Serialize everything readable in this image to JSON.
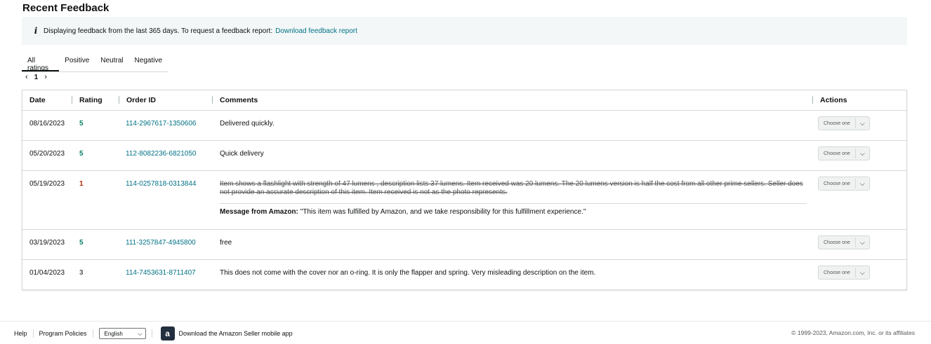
{
  "page": {
    "title": "Recent Feedback"
  },
  "info": {
    "icon": "info-icon",
    "text": "Displaying feedback from the last 365 days. To request a feedback report:",
    "link": "Download feedback report"
  },
  "tabs": [
    {
      "label": "All ratings",
      "active": true
    },
    {
      "label": "Positive",
      "active": false
    },
    {
      "label": "Neutral",
      "active": false
    },
    {
      "label": "Negative",
      "active": false
    }
  ],
  "pager": {
    "prev": "‹",
    "page": "1",
    "next": "›"
  },
  "table": {
    "headers": {
      "date": "Date",
      "rating": "Rating",
      "order_id": "Order ID",
      "comments": "Comments",
      "actions": "Actions"
    },
    "rows": [
      {
        "date": "08/16/2023",
        "rating": "5",
        "order_id": "114-2967617-1350606",
        "comment": "Delivered quickly.",
        "action": "Choose one"
      },
      {
        "date": "05/20/2023",
        "rating": "5",
        "order_id": "112-8082236-6821050",
        "comment": "Quick delivery",
        "action": "Choose one"
      },
      {
        "date": "05/19/2023",
        "rating": "1",
        "order_id": "114-0257818-0313844",
        "comment": "Item shows a flashlight with strength of 47 lumens , description lists 37 lumens. Item received was 20 lumens. The 20 lumens version is half the cost from all other prime sellers. Seller does not provide an accurate description of this item. Item received is not as the photo represents.",
        "message_label": "Message from Amazon:",
        "message_text": "\"This item was fulfilled by Amazon, and we take responsibility for this fulfillment experience.\"",
        "action": "Choose one"
      },
      {
        "date": "03/19/2023",
        "rating": "5",
        "order_id": "111-3257847-4945800",
        "comment": "free",
        "action": "Choose one"
      },
      {
        "date": "01/04/2023",
        "rating": "3",
        "order_id": "114-7453631-8711407",
        "comment": "This does not come with the cover nor an o-ring. It is only the flapper and spring. Very misleading description on the item.",
        "action": "Choose one"
      }
    ]
  },
  "footer": {
    "help": "Help",
    "policies": "Program Policies",
    "language": "English",
    "app_icon": "a",
    "app_text": "Download the Amazon Seller mobile app",
    "copyright": "© 1999-2023, Amazon.com, Inc. or its affiliates"
  },
  "colors": {
    "link": "#007185",
    "positive": "#067d62",
    "negative": "#b12704",
    "neutral": "#565959"
  }
}
